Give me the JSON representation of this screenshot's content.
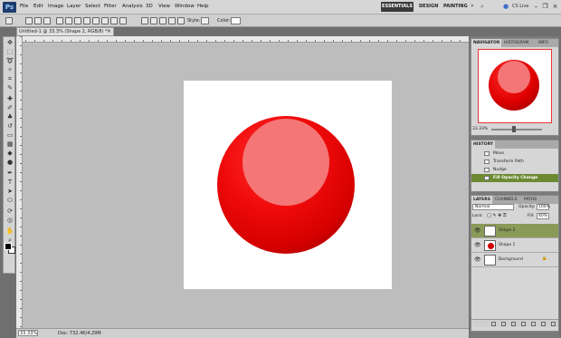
{
  "menubar": {
    "logo": "Ps",
    "items": [
      "File",
      "Edit",
      "Image",
      "Layer",
      "Select",
      "Filter",
      "Analysis",
      "3D",
      "View",
      "Window",
      "Help"
    ],
    "workspaces": [
      "ESSENTIALS",
      "DESIGN",
      "PAINTING"
    ],
    "cs_live": "CS Live"
  },
  "options": {
    "style_label": "Style:",
    "color_label": "Color:"
  },
  "document": {
    "tab_title": "Untitled-1 @ 33.3% (Shape 2, RGB/8) *",
    "close": "×"
  },
  "status": {
    "zoom": "33.33%",
    "doc_info": "Doc: 732.4K/4.29M"
  },
  "navigator": {
    "tabs": [
      "NAVIGATOR",
      "HISTOGRAM",
      "INFO"
    ],
    "zoom": "33.33%"
  },
  "history": {
    "tabs": [
      "HISTORY"
    ],
    "items": [
      "Move",
      "Transform Path",
      "Nudge",
      "Fill Opacity Change"
    ],
    "selected_index": 3
  },
  "layers": {
    "tabs": [
      "LAYERS",
      "CHANNELS",
      "PATHS"
    ],
    "blend_mode": "Normal",
    "opacity_label": "Opacity:",
    "opacity": "100%",
    "lock_label": "Lock:",
    "fill_label": "Fill:",
    "fill": "40%",
    "rows": [
      {
        "name": "Shape 2",
        "selected": true
      },
      {
        "name": "Shape 1",
        "selected": false
      },
      {
        "name": "Background",
        "selected": false,
        "locked": true
      }
    ]
  },
  "colors": {
    "sphere_red": "#e00000",
    "highlight_pink": "#f47676",
    "selection_green": "#6d8a33"
  },
  "icons": [
    "marquee-icon",
    "move-icon",
    "lasso-icon",
    "magic-wand-icon",
    "crop-icon",
    "eyedropper-icon",
    "brush-icon",
    "eraser-icon",
    "gradient-icon",
    "pen-icon",
    "type-icon",
    "shape-icon",
    "hand-icon",
    "zoom-icon",
    "eye-icon",
    "lock-icon"
  ]
}
